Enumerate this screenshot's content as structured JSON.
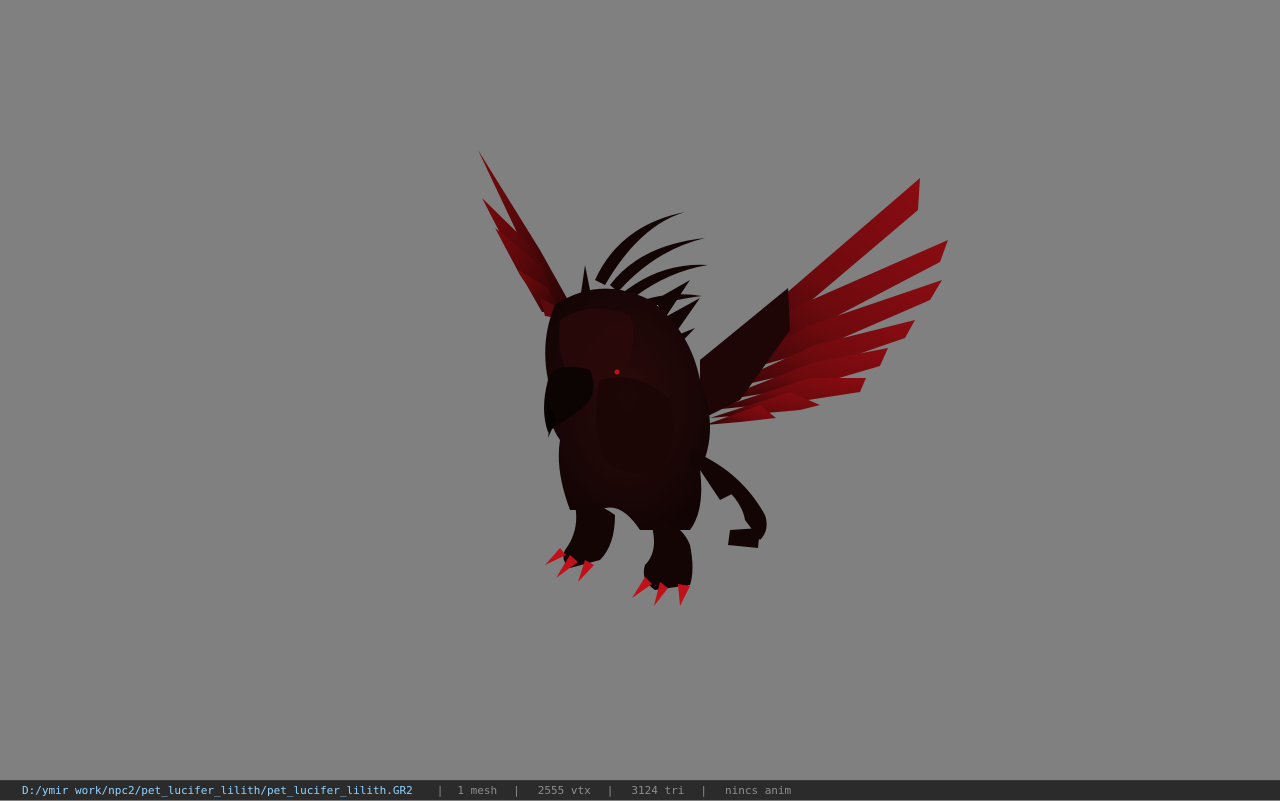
{
  "viewer": {
    "background_color": "#808080",
    "model_colors": {
      "body": "#1a0808",
      "feather": "#7a0a0e",
      "claw": "#c0101a"
    }
  },
  "status_bar": {
    "file_path": "D:/ymir work/npc2/pet_lucifer_lilith/pet_lucifer_lilith.GR2",
    "separator": "|",
    "mesh_count": "1 mesh",
    "vertex_count": "2555 vtx",
    "triangle_count": "3124 tri",
    "animation": "nincs anim"
  }
}
